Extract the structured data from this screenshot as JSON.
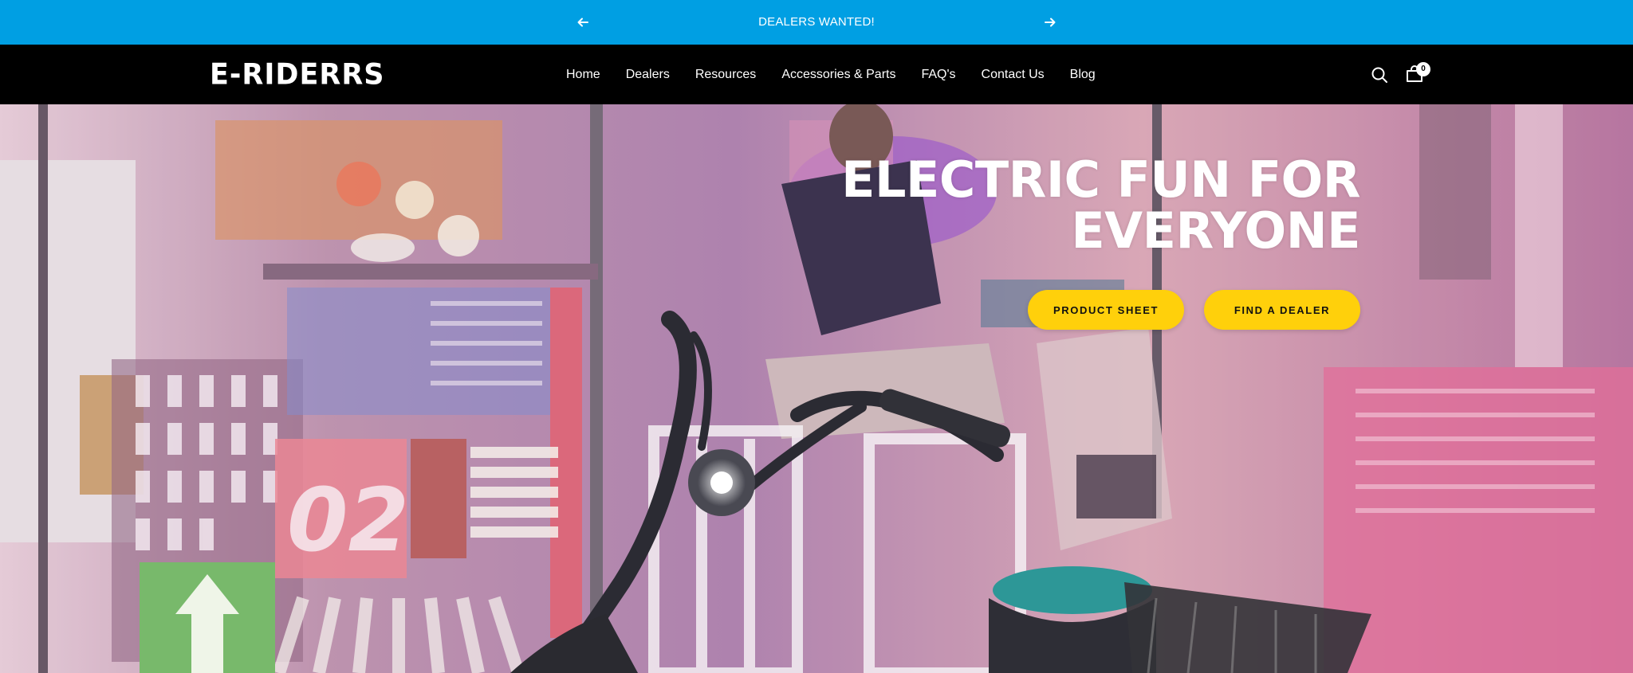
{
  "announcement": {
    "message": "DEALERS WANTED!",
    "prev_icon": "arrow-left-icon",
    "next_icon": "arrow-right-icon",
    "background": "#009fe3"
  },
  "header": {
    "logo_text": "E-RIDERRS",
    "nav": [
      {
        "label": "Home"
      },
      {
        "label": "Dealers"
      },
      {
        "label": "Resources"
      },
      {
        "label": "Accessories & Parts"
      },
      {
        "label": "FAQ's"
      },
      {
        "label": "Contact Us"
      },
      {
        "label": "Blog"
      }
    ],
    "search_icon": "search-icon",
    "cart_icon": "cart-icon",
    "cart_count": "0"
  },
  "hero": {
    "title_line1": "ELECTRIC FUN FOR",
    "title_line2": "EVERYONE",
    "buttons": [
      {
        "label": "PRODUCT SHEET"
      },
      {
        "label": "FIND A DEALER"
      }
    ],
    "button_color": "#ffd00b",
    "image": "neon-scooter-arcade-photo"
  }
}
